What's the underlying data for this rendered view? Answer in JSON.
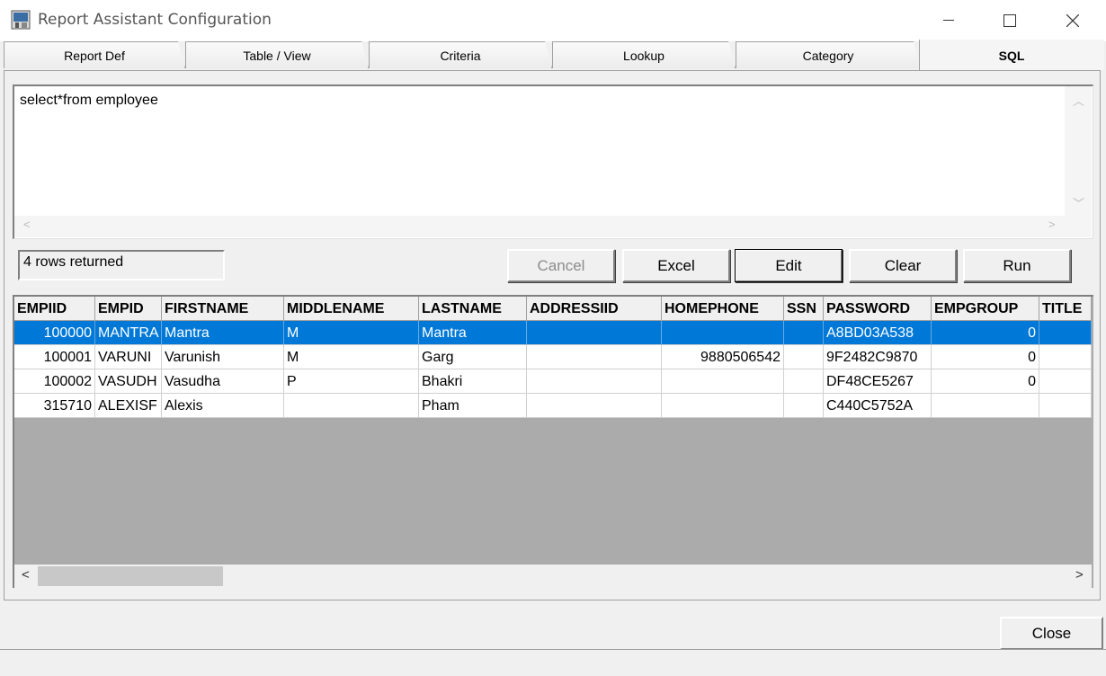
{
  "window": {
    "title": "Report Assistant Configuration",
    "minimize_glyph": "—",
    "maximize_glyph": "☐",
    "close_glyph": "✕"
  },
  "tabs": [
    {
      "label": "Report Def",
      "active": false
    },
    {
      "label": "Table / View",
      "active": false
    },
    {
      "label": "Criteria",
      "active": false
    },
    {
      "label": "Lookup",
      "active": false
    },
    {
      "label": "Category",
      "active": false
    },
    {
      "label": "SQL",
      "active": true
    }
  ],
  "sql": {
    "query": "select*from employee",
    "status": "4 rows returned"
  },
  "buttons": {
    "cancel": "Cancel",
    "excel": "Excel",
    "edit": "Edit",
    "clear": "Clear",
    "run": "Run",
    "close": "Close"
  },
  "grid": {
    "columns": [
      "EMPIID",
      "EMPID",
      "FIRSTNAME",
      "MIDDLENAME",
      "LASTNAME",
      "ADDRESSIID",
      "HOMEPHONE",
      "SSN",
      "PASSWORD",
      "EMPGROUP",
      "TITLE"
    ],
    "rows": [
      [
        "100000",
        "MANTRA",
        "Mantra",
        "M",
        "Mantra",
        "",
        "",
        "",
        "A8BD03A538",
        "0",
        ""
      ],
      [
        "100001",
        "VARUNI",
        "Varunish",
        "M",
        "Garg",
        "",
        "9880506542",
        "",
        "9F2482C9870",
        "0",
        ""
      ],
      [
        "100002",
        "VASUDH",
        "Vasudha",
        "P",
        "Bhakri",
        "",
        "",
        "",
        "DF48CE5267",
        "0",
        ""
      ],
      [
        "315710",
        "ALEXISF",
        "Alexis",
        "",
        "Pham",
        "",
        "",
        "",
        "C440C5752A",
        "",
        ""
      ]
    ],
    "selected_row": 0
  },
  "colors": {
    "selection": "#0078d7",
    "grid_background": "#ababab",
    "dialog_background": "#f0f0f0"
  }
}
